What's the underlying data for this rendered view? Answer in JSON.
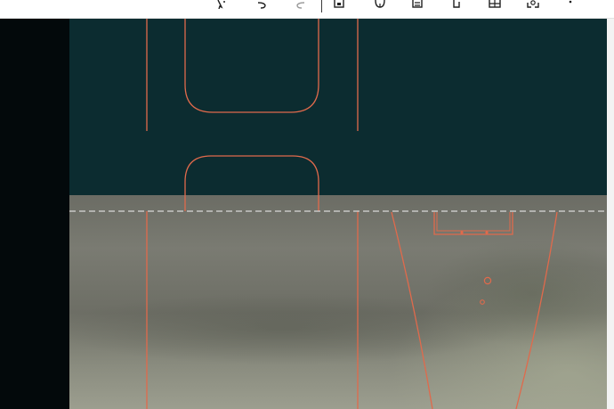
{
  "toolbar": {
    "icons": [
      "cursor-sparkle-icon",
      "undo-icon",
      "redo-icon",
      "save-icon",
      "copy-icon",
      "page-icon",
      "document-icon",
      "table-icon",
      "focus-icon",
      "more-icon"
    ]
  },
  "colors": {
    "canvas_teal": "#0c2c30",
    "outline_orange": "#e06a4c",
    "left_panel": "#03090b",
    "guide_line": "#d9d9d9"
  }
}
